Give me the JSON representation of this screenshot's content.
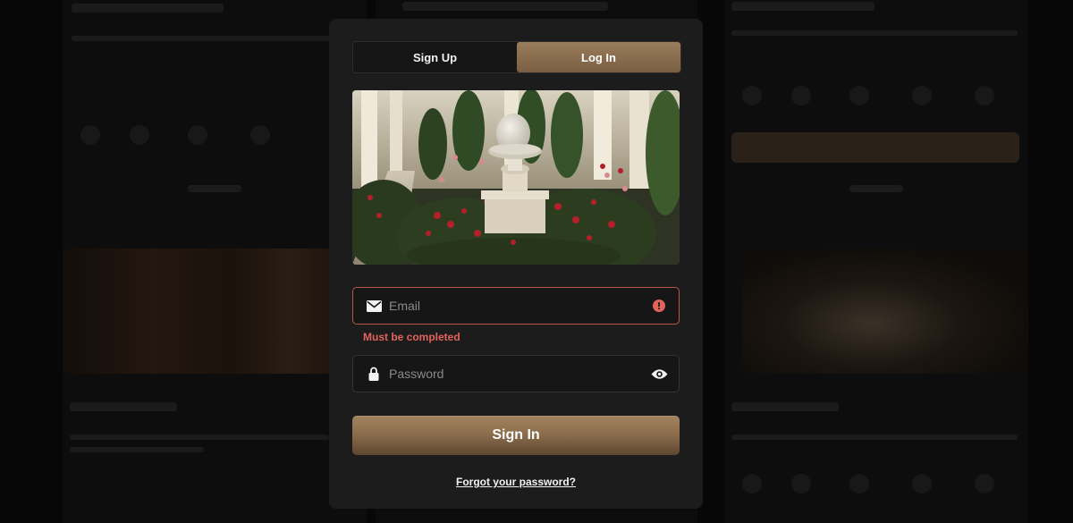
{
  "tabs": [
    {
      "label": "Sign Up",
      "active": false
    },
    {
      "label": "Log In",
      "active": true
    }
  ],
  "hero_image": {
    "icon": "garden-bust-with-hat-image"
  },
  "email": {
    "placeholder": "Email",
    "value": "",
    "error_message": "Must be completed",
    "state": "error"
  },
  "password": {
    "placeholder": "Password",
    "value": ""
  },
  "submit_label": "Sign In",
  "forgot_label": "Forgot your password?",
  "colors": {
    "accent": "#8d6f4e",
    "error": "#e0645a",
    "modal_bg": "#1c1c1c",
    "page_bg": "#070707"
  }
}
